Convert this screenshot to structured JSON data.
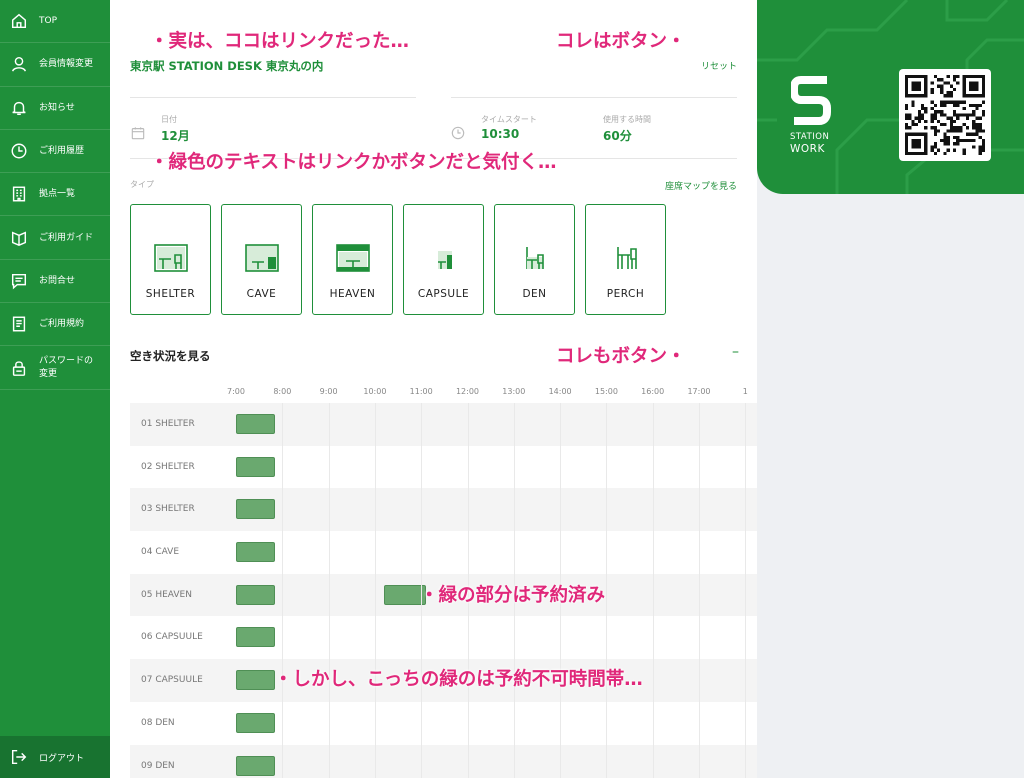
{
  "sidebar": {
    "items": [
      {
        "label": "TOP",
        "icon": "home-icon"
      },
      {
        "label": "会員情報変更",
        "icon": "user-icon"
      },
      {
        "label": "お知らせ",
        "icon": "bell-icon"
      },
      {
        "label": "ご利用履歴",
        "icon": "clock-icon"
      },
      {
        "label": "拠点一覧",
        "icon": "building-icon"
      },
      {
        "label": "ご利用ガイド",
        "icon": "book-icon"
      },
      {
        "label": "お問合せ",
        "icon": "message-icon"
      },
      {
        "label": "ご利用規約",
        "icon": "document-icon"
      },
      {
        "label": "パスワードの\n変更",
        "icon": "lock-icon"
      }
    ],
    "logout": "ログアウト"
  },
  "booking": {
    "location": "東京駅 STATION DESK 東京丸の内",
    "reset": "リセット",
    "date_label": "日付",
    "date_value": "12月",
    "start_label": "タイムスタート",
    "start_value": "10:30",
    "duration_label": "使用する時間",
    "duration_value": "60分",
    "type_label": "タイプ",
    "seat_map_link": "座席マップを見る",
    "types": [
      "SHELTER",
      "CAVE",
      "HEAVEN",
      "CAPSULE",
      "DEN",
      "PERCH"
    ]
  },
  "availability": {
    "title": "空き状況を見る",
    "collapse_symbol": "–",
    "hours": [
      "7:00",
      "8:00",
      "9:00",
      "10:00",
      "11:00",
      "12:00",
      "13:00",
      "14:00",
      "15:00",
      "16:00",
      "17:00",
      "1"
    ],
    "rows": [
      {
        "name": "01 SHELTER",
        "blocks": [
          [
            7.0,
            7.85
          ]
        ]
      },
      {
        "name": "02 SHELTER",
        "blocks": [
          [
            7.0,
            7.85
          ]
        ]
      },
      {
        "name": "03 SHELTER",
        "blocks": [
          [
            7.0,
            7.85
          ]
        ]
      },
      {
        "name": "04 CAVE",
        "blocks": [
          [
            7.0,
            7.85
          ]
        ]
      },
      {
        "name": "05 HEAVEN",
        "blocks": [
          [
            7.0,
            7.85
          ],
          [
            10.2,
            11.1
          ]
        ]
      },
      {
        "name": "06 CAPSUULE",
        "blocks": [
          [
            7.0,
            7.85
          ]
        ]
      },
      {
        "name": "07 CAPSUULE",
        "blocks": [
          [
            7.0,
            7.85
          ]
        ]
      },
      {
        "name": "08 DEN",
        "blocks": [
          [
            7.0,
            7.85
          ]
        ]
      },
      {
        "name": "09 DEN",
        "blocks": [
          [
            7.0,
            7.85
          ]
        ]
      }
    ]
  },
  "brand": {
    "line1": "STATION",
    "line2": "WORK"
  },
  "annotations": {
    "a1": "・実は、ココはリンクだった…",
    "a2": "コレはボタン・",
    "a3": "・緑色のテキストはリンクかボタンだと気付く…",
    "a4": "コレもボタン・",
    "a5": "・緑の部分は予約済み",
    "a6": "・しかし、こっちの緑のは予約不可時間帯…"
  },
  "colors": {
    "primary_green": "#1f8f3a",
    "block_green": "#6aa96f",
    "annotation_pink": "#e0287a"
  }
}
